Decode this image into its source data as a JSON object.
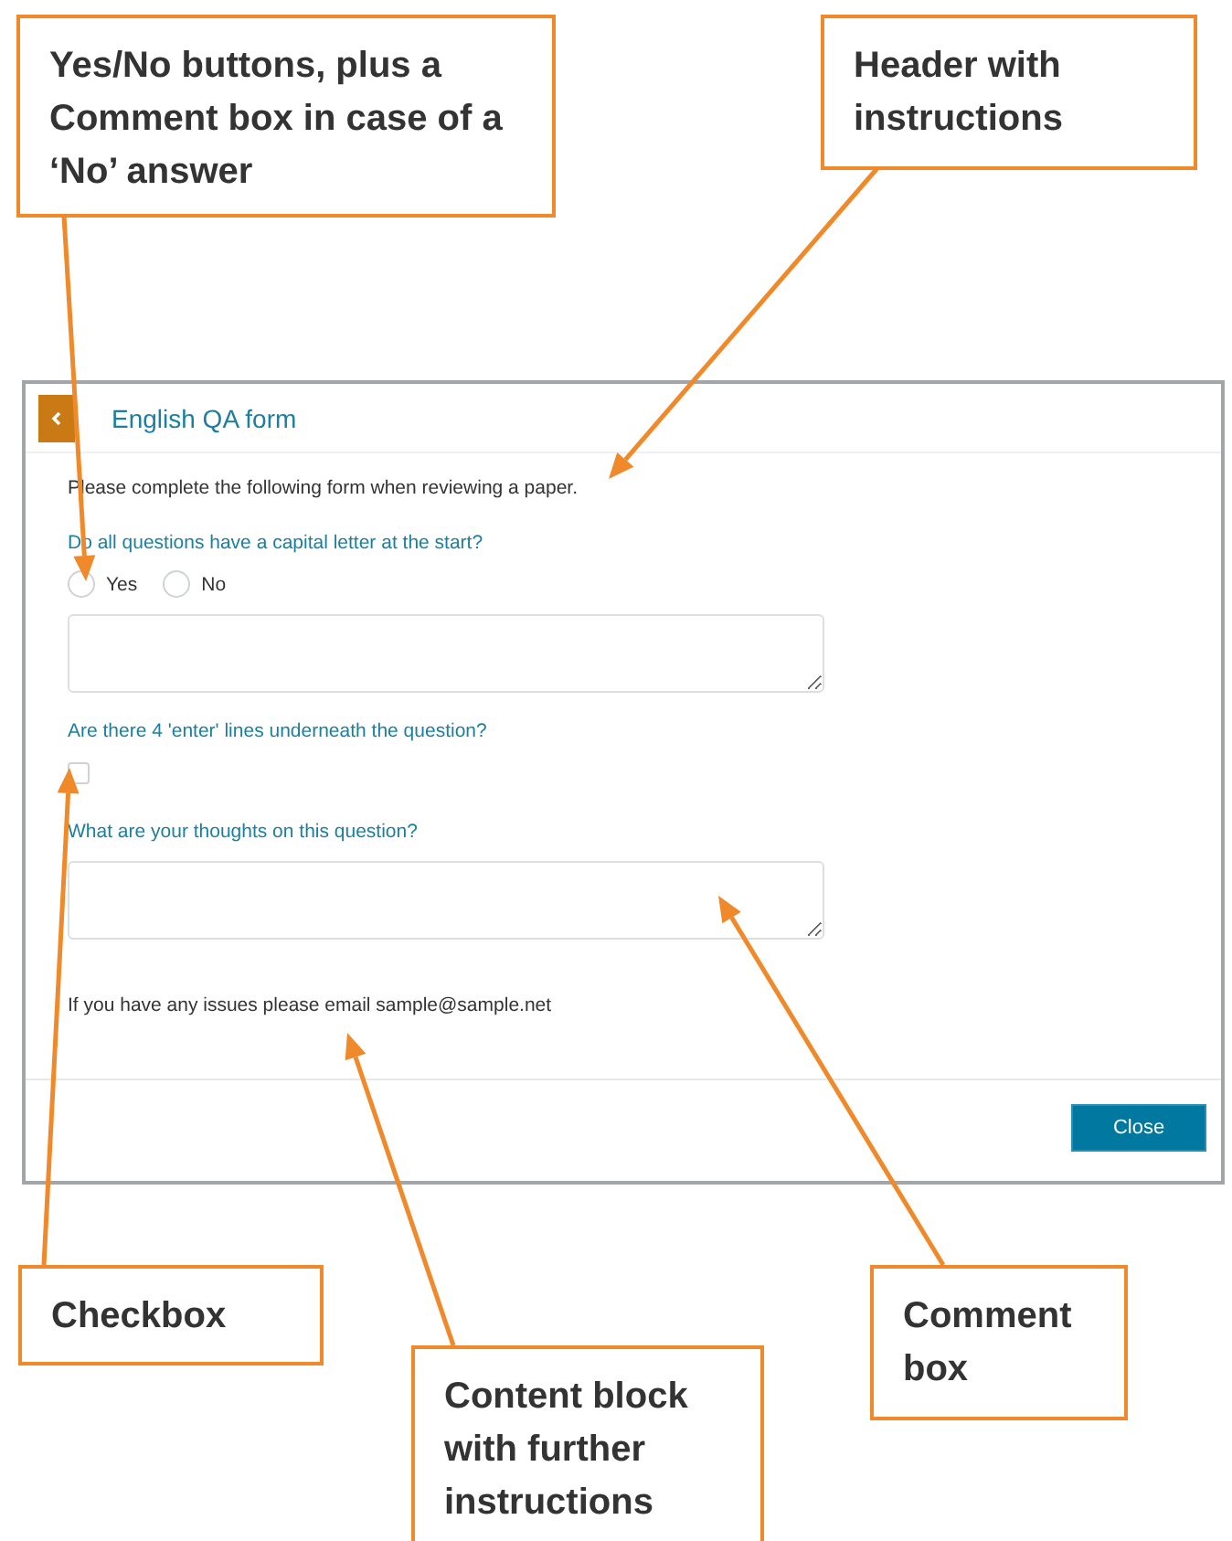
{
  "dialog": {
    "title": "English QA form",
    "intro": "Please complete the following form when reviewing a paper.",
    "questions": [
      {
        "kind": "radio",
        "label": "Do all questions have a capital letter at the start?",
        "options": [
          {
            "label": "Yes",
            "selected": false
          },
          {
            "label": "No",
            "selected": false
          }
        ],
        "comment_box": true
      },
      {
        "kind": "checkbox",
        "label": "Are there 4 'enter' lines underneath the question?",
        "checked": false
      },
      {
        "kind": "textarea",
        "label": "What are your thoughts on this question?"
      }
    ],
    "note": "If you have any issues please email sample@sample.net",
    "buttons": [
      "Close"
    ]
  },
  "callouts": [
    {
      "text": "Yes/No buttons, plus a Comment box in case of a ‘No’ answer"
    },
    {
      "text": "Header with instructions"
    },
    {
      "text": "Checkbox"
    },
    {
      "text": "Comment box"
    },
    {
      "text": "Content block with further instructions"
    }
  ]
}
